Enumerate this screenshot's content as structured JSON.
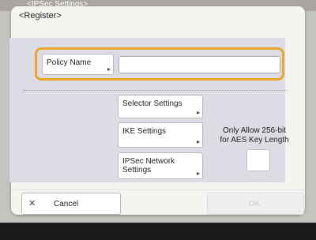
{
  "background_title": "<IPSec Settings>",
  "dialog": {
    "title": "<Register>",
    "policy_name": {
      "label": "Policy Name",
      "value": ""
    },
    "buttons": {
      "selector": "Selector Settings",
      "ike": "IKE Settings",
      "ipsec_line1": "IPSec Network",
      "ipsec_line2": "Settings"
    },
    "aes": {
      "line1": "Only Allow 256-bit",
      "line2": "for AES Key Length",
      "checked": false
    },
    "footer": {
      "cancel": "Cancel",
      "ok": "OK"
    }
  },
  "icons": {
    "arrow": "▸",
    "close": "✕"
  },
  "colors": {
    "highlight": "#e9a62e",
    "panel": "#dcdde4"
  }
}
